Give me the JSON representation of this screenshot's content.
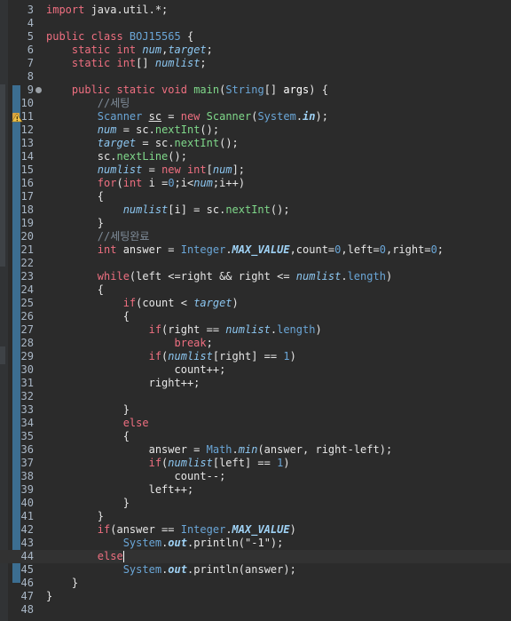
{
  "editor": {
    "line_numbers": [
      "3",
      "4",
      "5",
      "6",
      "7",
      "8",
      "9",
      "10",
      "11",
      "12",
      "13",
      "14",
      "15",
      "16",
      "17",
      "18",
      "19",
      "20",
      "21",
      "22",
      "23",
      "24",
      "25",
      "26",
      "27",
      "28",
      "29",
      "30",
      "31",
      "32",
      "33",
      "34",
      "35",
      "36",
      "37",
      "38",
      "39",
      "40",
      "41",
      "42",
      "43",
      "44",
      "45",
      "46",
      "47",
      "48"
    ],
    "fold_marker_line": "9",
    "warning_line": "11",
    "current_line": "44",
    "lines": [
      [
        [
          "k",
          "import "
        ],
        [
          "p",
          "java.util.*;"
        ]
      ],
      [],
      [
        [
          "k",
          "public class "
        ],
        [
          "t",
          "BOJ15565"
        ],
        [
          "p",
          " {"
        ]
      ],
      [
        [
          "p",
          "    "
        ],
        [
          "k",
          "static int "
        ],
        [
          "fi",
          "num"
        ],
        [
          "p",
          ","
        ],
        [
          "fi",
          "target"
        ],
        [
          "p",
          ";"
        ]
      ],
      [
        [
          "p",
          "    "
        ],
        [
          "k",
          "static int"
        ],
        [
          "p",
          "[] "
        ],
        [
          "fi",
          "numlist"
        ],
        [
          "p",
          ";"
        ]
      ],
      [],
      [
        [
          "p",
          "    "
        ],
        [
          "k",
          "public static void "
        ],
        [
          "f",
          "main"
        ],
        [
          "p",
          "("
        ],
        [
          "t",
          "String"
        ],
        [
          "p",
          "[] "
        ],
        [
          "v",
          "args"
        ],
        [
          "p",
          ") {"
        ]
      ],
      [
        [
          "p",
          "        "
        ],
        [
          "cm",
          "//세팅"
        ]
      ],
      [
        [
          "p",
          "        "
        ],
        [
          "t",
          "Scanner "
        ],
        [
          "u",
          "sc"
        ],
        [
          "p",
          " = "
        ],
        [
          "k",
          "new "
        ],
        [
          "f",
          "Scanner"
        ],
        [
          "p",
          "("
        ],
        [
          "t",
          "System"
        ],
        [
          "p",
          "."
        ],
        [
          "st",
          "in"
        ],
        [
          "p",
          ");"
        ]
      ],
      [
        [
          "p",
          "        "
        ],
        [
          "fi",
          "num"
        ],
        [
          "p",
          " = sc."
        ],
        [
          "f",
          "nextInt"
        ],
        [
          "p",
          "();"
        ]
      ],
      [
        [
          "p",
          "        "
        ],
        [
          "fi",
          "target"
        ],
        [
          "p",
          " = sc."
        ],
        [
          "f",
          "nextInt"
        ],
        [
          "p",
          "();"
        ]
      ],
      [
        [
          "p",
          "        sc."
        ],
        [
          "f",
          "nextLine"
        ],
        [
          "p",
          "();"
        ]
      ],
      [
        [
          "p",
          "        "
        ],
        [
          "fi",
          "numlist"
        ],
        [
          "p",
          " = "
        ],
        [
          "k",
          "new int"
        ],
        [
          "p",
          "["
        ],
        [
          "fi",
          "num"
        ],
        [
          "p",
          "];"
        ]
      ],
      [
        [
          "p",
          "        "
        ],
        [
          "k",
          "for"
        ],
        [
          "p",
          "("
        ],
        [
          "k",
          "int "
        ],
        [
          "p",
          "i ="
        ],
        [
          "nb",
          "0"
        ],
        [
          "p",
          ";i<"
        ],
        [
          "fi",
          "num"
        ],
        [
          "p",
          ";i++)"
        ]
      ],
      [
        [
          "p",
          "        {"
        ]
      ],
      [
        [
          "p",
          "            "
        ],
        [
          "fi",
          "numlist"
        ],
        [
          "p",
          "[i] = sc."
        ],
        [
          "f",
          "nextInt"
        ],
        [
          "p",
          "();"
        ]
      ],
      [
        [
          "p",
          "        }"
        ]
      ],
      [
        [
          "p",
          "        "
        ],
        [
          "cm",
          "//세팅완료"
        ]
      ],
      [
        [
          "p",
          "        "
        ],
        [
          "k",
          "int "
        ],
        [
          "p",
          "answer = "
        ],
        [
          "t",
          "Integer"
        ],
        [
          "p",
          "."
        ],
        [
          "st",
          "MAX_VALUE"
        ],
        [
          "p",
          ",count="
        ],
        [
          "nb",
          "0"
        ],
        [
          "p",
          ",left="
        ],
        [
          "nb",
          "0"
        ],
        [
          "p",
          ",right="
        ],
        [
          "nb",
          "0"
        ],
        [
          "p",
          ";"
        ]
      ],
      [],
      [
        [
          "p",
          "        "
        ],
        [
          "k",
          "while"
        ],
        [
          "p",
          "(left <=right && right <= "
        ],
        [
          "fi",
          "numlist"
        ],
        [
          "p",
          "."
        ],
        [
          "t",
          "length"
        ],
        [
          "p",
          ")"
        ]
      ],
      [
        [
          "p",
          "        {"
        ]
      ],
      [
        [
          "p",
          "            "
        ],
        [
          "k",
          "if"
        ],
        [
          "p",
          "(count < "
        ],
        [
          "fi",
          "target"
        ],
        [
          "p",
          ")"
        ]
      ],
      [
        [
          "p",
          "            {"
        ]
      ],
      [
        [
          "p",
          "                "
        ],
        [
          "k",
          "if"
        ],
        [
          "p",
          "(right == "
        ],
        [
          "fi",
          "numlist"
        ],
        [
          "p",
          "."
        ],
        [
          "t",
          "length"
        ],
        [
          "p",
          ")"
        ]
      ],
      [
        [
          "p",
          "                    "
        ],
        [
          "k",
          "break"
        ],
        [
          "p",
          ";"
        ]
      ],
      [
        [
          "p",
          "                "
        ],
        [
          "k",
          "if"
        ],
        [
          "p",
          "("
        ],
        [
          "fi",
          "numlist"
        ],
        [
          "p",
          "[right] == "
        ],
        [
          "nb",
          "1"
        ],
        [
          "p",
          ")"
        ]
      ],
      [
        [
          "p",
          "                    count++;"
        ]
      ],
      [
        [
          "p",
          "                right++;"
        ]
      ],
      [],
      [
        [
          "p",
          "            }"
        ]
      ],
      [
        [
          "p",
          "            "
        ],
        [
          "k",
          "else"
        ]
      ],
      [
        [
          "p",
          "            {"
        ]
      ],
      [
        [
          "p",
          "                answer = "
        ],
        [
          "t",
          "Math"
        ],
        [
          "p",
          "."
        ],
        [
          "fi",
          "min"
        ],
        [
          "p",
          "(answer, right-left);"
        ]
      ],
      [
        [
          "p",
          "                "
        ],
        [
          "k",
          "if"
        ],
        [
          "p",
          "("
        ],
        [
          "fi",
          "numlist"
        ],
        [
          "p",
          "[left] == "
        ],
        [
          "nb",
          "1"
        ],
        [
          "p",
          ")"
        ]
      ],
      [
        [
          "p",
          "                    count--;"
        ]
      ],
      [
        [
          "p",
          "                left++;"
        ]
      ],
      [
        [
          "p",
          "            }"
        ]
      ],
      [
        [
          "p",
          "        }"
        ]
      ],
      [
        [
          "p",
          "        "
        ],
        [
          "k",
          "if"
        ],
        [
          "p",
          "(answer == "
        ],
        [
          "t",
          "Integer"
        ],
        [
          "p",
          "."
        ],
        [
          "st",
          "MAX_VALUE"
        ],
        [
          "p",
          ")"
        ]
      ],
      [
        [
          "p",
          "            "
        ],
        [
          "t",
          "System"
        ],
        [
          "p",
          "."
        ],
        [
          "st",
          "out"
        ],
        [
          "p",
          "."
        ],
        [
          "p",
          "println("
        ],
        [
          "s",
          "\"-1\""
        ],
        [
          "p",
          ");"
        ]
      ],
      [
        [
          "p",
          "        "
        ],
        [
          "k",
          "else"
        ]
      ],
      [
        [
          "p",
          "            "
        ],
        [
          "t",
          "System"
        ],
        [
          "p",
          "."
        ],
        [
          "st",
          "out"
        ],
        [
          "p",
          "."
        ],
        [
          "p",
          "println(answer);"
        ]
      ],
      [
        [
          "p",
          "    }"
        ]
      ],
      [
        [
          "p",
          "}"
        ]
      ],
      []
    ]
  },
  "colors": {
    "background": "#2b2b2b",
    "keyword": "#ee6f80",
    "type": "#6aa6d7",
    "method": "#7fd88a",
    "field": "#8cc6f0",
    "comment": "#7f8c99",
    "line_change_marker": "#3c6e91"
  },
  "icons": {
    "fold": "circle-minus-icon",
    "warning": "warning-lightbulb-icon"
  }
}
